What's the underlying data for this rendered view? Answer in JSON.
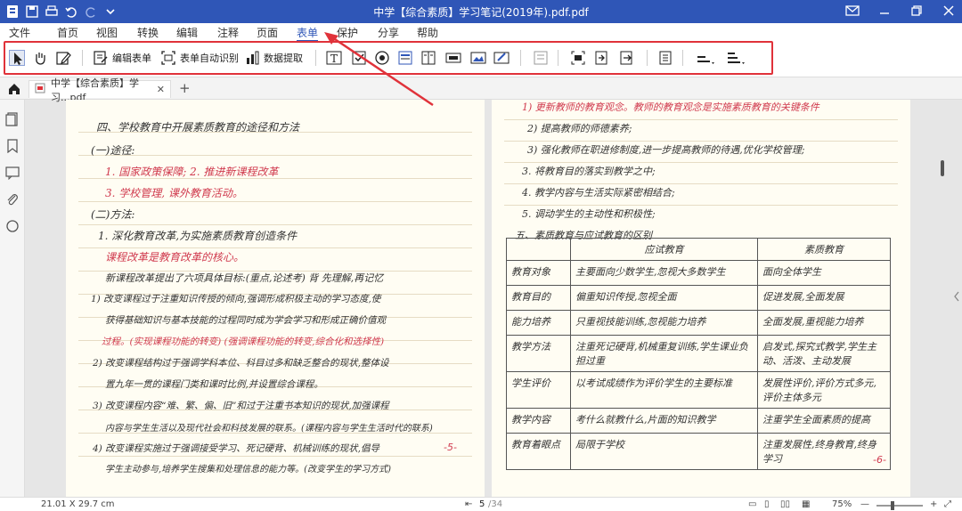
{
  "window": {
    "title": "中学【综合素质】学习笔记(2019年).pdf.pdf",
    "controls": [
      "mail-icon",
      "minimize-icon",
      "restore-icon",
      "close-icon"
    ]
  },
  "quick_access": [
    "save-icon",
    "print-icon",
    "undo-icon",
    "redo-icon",
    "dropdown-icon"
  ],
  "menu": {
    "items": [
      "文件",
      "首页",
      "视图",
      "转换",
      "编辑",
      "注释",
      "页面",
      "表单",
      "保护",
      "分享",
      "帮助"
    ],
    "active": "表单"
  },
  "toolbar": {
    "select_icon": "cursor-icon",
    "hand_icon": "hand-icon",
    "edit_icon": "edit-icon",
    "edit_form": "编辑表单",
    "auto_recognize": "表单自动识别",
    "data_extract": "数据提取",
    "form_tools": [
      "text-field-icon",
      "checkbox-icon",
      "radio-icon",
      "combo-box-icon",
      "list-box-icon",
      "button-icon",
      "image-icon",
      "signature-icon",
      "barcode-icon",
      "calc-icon",
      "import-icon",
      "export-icon",
      "clear-icon",
      "align-icon",
      "distribute-icon"
    ]
  },
  "tabs": {
    "doc_tab": "中学【综合素质】学习...pdf",
    "add": "+"
  },
  "sidebar": [
    "thumbnail-icon",
    "bookmark-icon",
    "comment-icon",
    "attachment-icon",
    "search-icon"
  ],
  "page_left": {
    "heading": "四、学校教育中开展素质教育的途径和方法",
    "l1": "(一)途径:",
    "l2": "1. 国家政策保障;  2.  推进新课程改革",
    "l3": "3. 学校管理,  课外教育活动。",
    "l4": "(二)方法:",
    "l5": "1. 深化教育改革,为实施素质教育创造条件",
    "l6": "课程改革是教育改革的核心。",
    "l7": "新课程改革提出了六项具体目标:(重点,论述考)  背  先理解,再记忆",
    "l8": "1) 改变课程过于注重知识传授的倾向,强调形成积极主动的学习态度,使",
    "l9": "获得基础知识与基本技能的过程同时成为学会学习和形成正确价值观",
    "l10": "过程。(实现课程功能的转变)   (强调课程功能的转变,综合化和选择性)",
    "l11": "2) 改变课程结构过于强调学科本位、科目过多和缺乏整合的现状,整体设",
    "l12": "置九年一贯的课程门类和课时比例,并设置综合课程。",
    "l13": "3) 改变课程内容“难、繁、偏、旧”和过于注重书本知识的现状,加强课程",
    "l14": "内容与学生生活以及现代社会和科技发展的联系。(课程内容与学生生活时代的联系)",
    "l15": "4) 改变课程实施过于强调接受学习、死记硬背、机械训练的现状,倡导",
    "l16": "学生主动参与,培养学生搜集和处理信息的能力等。(改变学生的学习方式)",
    "page_num": "-5-"
  },
  "page_right": {
    "r1": "1) 更新教师的教育观念。教师的教育观念是实施素质教育的关键条件",
    "r2": "2) 提高教师的师德素养;",
    "r3": "3) 强化教师在职进修制度,进一步提高教师的待遇,优化学校管理;",
    "r4": "3. 将教育目的落实到教学之中;",
    "r5": "4. 教学内容与生活实际紧密相结合;",
    "r6": "5. 调动学生的主动性和积极性;",
    "table_title": "五、素质教育与应试教育的区别",
    "table": {
      "headers": [
        "",
        "应试教育",
        "素质教育"
      ],
      "rows": [
        [
          "教育对象",
          "主要面向少数学生,忽视大多数学生",
          "面向全体学生"
        ],
        [
          "教育目的",
          "偏重知识传授,忽视全面",
          "促进发展,全面发展"
        ],
        [
          "能力培养",
          "只重视技能训练,忽视能力培养",
          "全面发展,重视能力培养"
        ],
        [
          "教学方法",
          "注重死记硬背,机械重复训练,学生课业负担过重",
          "启发式,探究式教学,学生主动、活泼、主动发展"
        ],
        [
          "学生评价",
          "以考试成绩作为评价学生的主要标准",
          "发展性评价,评价方式多元,评价主体多元"
        ],
        [
          "教学内容",
          "考什么就教什么,片面的知识教学",
          "注重学生全面素质的提高"
        ],
        [
          "教育着眼点",
          "局限于学校",
          "注重发展性,终身教育,终身学习"
        ]
      ]
    },
    "page_num": "-6-"
  },
  "status": {
    "page_size": "21.01 X 29.7 cm",
    "current_page": "5",
    "total_pages": "/34",
    "zoom": "75%"
  },
  "colors": {
    "title_bar": "#2f56b7",
    "highlight_box": "#e0323a",
    "annotation_red": "#d03a4e"
  }
}
